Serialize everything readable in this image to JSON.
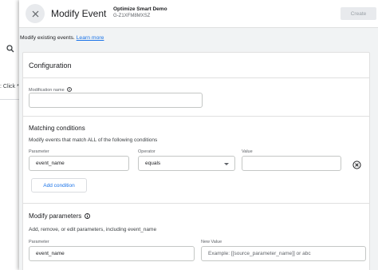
{
  "background": {
    "search_icon": "search-icon",
    "row_text": ": Click *"
  },
  "header": {
    "close_icon": "close-icon",
    "title": "Modify Event",
    "property_name": "Optimize Smart Demo",
    "property_id": "G-Z1XFM8MXSZ",
    "create_label": "Create"
  },
  "info": {
    "text": "Modify existing events.",
    "link": "Learn more"
  },
  "configuration": {
    "title": "Configuration",
    "modification_name": {
      "label": "Modification name",
      "value": "",
      "help_icon": "help-icon"
    },
    "matching": {
      "title": "Matching conditions",
      "description": "Modify events that match ALL of the following conditions",
      "parameter_label": "Parameter",
      "operator_label": "Operator",
      "value_label": "Value",
      "parameter_value": "event_name",
      "operator_value": "equals",
      "value_value": "",
      "remove_icon": "remove-circle-icon",
      "add_condition_label": "Add condition"
    },
    "modify_parameters": {
      "title": "Modify parameters",
      "help_icon": "help-icon",
      "description": "Add, remove, or edit parameters, including event_name",
      "parameter_label": "Parameter",
      "new_value_label": "New Value",
      "parameter_value": "event_name",
      "new_value_placeholder": "Example: [[source_parameter_name]] or abc"
    }
  },
  "colors": {
    "accent": "#1a73e8",
    "panel_bg": "#f1f3f4"
  }
}
